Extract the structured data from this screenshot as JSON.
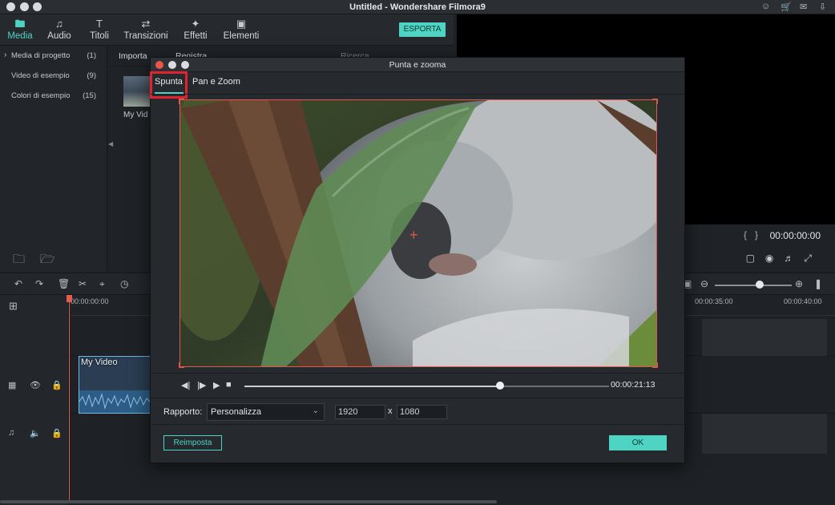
{
  "window": {
    "title": "Untitled - Wondershare Filmora9"
  },
  "top_icons": [
    "user-icon",
    "cart-icon",
    "mail-icon",
    "download-icon"
  ],
  "nav": {
    "tabs": [
      {
        "label": "Media",
        "icon": "folder-icon",
        "active": true
      },
      {
        "label": "Audio",
        "icon": "music-note-icon",
        "active": false
      },
      {
        "label": "Titoli",
        "icon": "text-icon",
        "active": false
      },
      {
        "label": "Transizioni",
        "icon": "transition-icon",
        "active": false
      },
      {
        "label": "Effetti",
        "icon": "effects-icon",
        "active": false
      },
      {
        "label": "Elementi",
        "icon": "image-icon",
        "active": false
      }
    ],
    "export_label": "ESPORTA"
  },
  "sidebar": {
    "items": [
      {
        "label": "Media di progetto",
        "count": "(1)"
      },
      {
        "label": "Video di esempio",
        "count": "(9)"
      },
      {
        "label": "Colori di esempio",
        "count": "(15)"
      }
    ]
  },
  "media": {
    "import_label": "Importa",
    "record_label": "Registra",
    "search_placeholder": "Ricerca",
    "item_name": "My Vid"
  },
  "preview": {
    "timecode": "00:00:00:00"
  },
  "timeline": {
    "ruler_labels": [
      "00:00:00:00",
      "00:00:35:00",
      "00:00:40:00"
    ],
    "clip_label": "My Video"
  },
  "modal": {
    "title": "Punta e zooma",
    "tabs": [
      {
        "label": "Spunta",
        "active": true
      },
      {
        "label": "Pan e Zoom",
        "active": false
      }
    ],
    "player_time": "00:00:21:13",
    "progress": 0.7,
    "ratio_label": "Rapporto:",
    "ratio_value": "Personalizza",
    "width": "1920",
    "height": "1080",
    "times_sign": "x",
    "reset_label": "Reimposta",
    "ok_label": "OK"
  },
  "colors": {
    "accent": "#4fd3c2",
    "crop_border": "#e2574a",
    "highlight": "#e0242e",
    "playhead": "#e35b4f"
  }
}
